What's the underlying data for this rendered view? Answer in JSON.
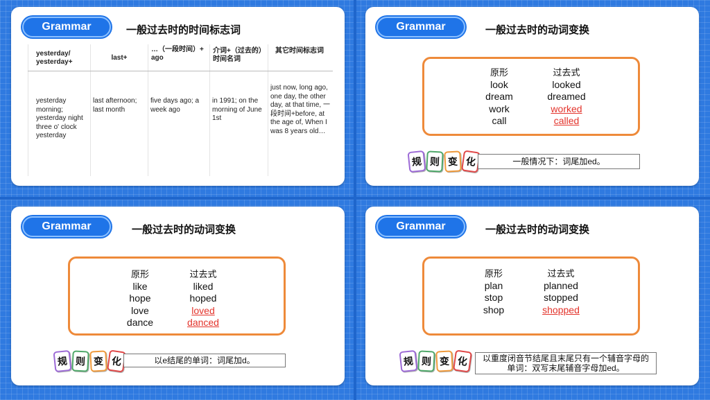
{
  "slide1": {
    "badge": "Grammar",
    "title": "一般过去时的时间标志词",
    "headers": [
      "yesterday/ yesterday+",
      "last+",
      "…（一段时间）+ ago",
      "介词+（过去的）时间名词",
      "其它时间标志词"
    ],
    "cells": [
      "yesterday morning; yesterday night  three o' clock yesterday",
      "last afternoon; last month",
      "five days ago; a week ago",
      "in 1991;  on the morning of June 1st",
      "just now, long ago, one day,  the other day, at that time, 一段时间+before, at the age of, When I was 8 years old…"
    ]
  },
  "slide2": {
    "badge": "Grammar",
    "title": "一般过去时的动词变换",
    "col1_header": "原形",
    "col2_header": "过去式",
    "base": [
      "look",
      "dream",
      "work",
      "call"
    ],
    "past": [
      "looked",
      "dreamed",
      "worked",
      "called"
    ],
    "tiles": [
      "规",
      "则",
      "变",
      "化"
    ],
    "rule": "一般情况下：词尾加ed。"
  },
  "slide3": {
    "badge": "Grammar",
    "title": "一般过去时的动词变换",
    "col1_header": "原形",
    "col2_header": "过去式",
    "base": [
      "like",
      "hope",
      "love",
      "dance"
    ],
    "past": [
      "liked",
      "hoped",
      "loved",
      "danced"
    ],
    "tiles": [
      "规",
      "则",
      "变",
      "化"
    ],
    "rule": "以e结尾的单词：词尾加d。"
  },
  "slide4": {
    "badge": "Grammar",
    "title": "一般过去时的动词变换",
    "col1_header": "原形",
    "col2_header": "过去式",
    "base": [
      "plan",
      "stop",
      "shop"
    ],
    "past": [
      "planned",
      "stopped",
      "shopped"
    ],
    "tiles": [
      "规",
      "则",
      "变",
      "化"
    ],
    "rule_line1": "以重度闭音节结尾且末尾只有一个辅音字母的",
    "rule_line2": "单词：双写末尾辅音字母加ed。"
  },
  "colors": {
    "background": "#2f7ae0",
    "badge": "#1f74e8",
    "box_border": "#ee8a3a",
    "highlight": "#e3332b"
  }
}
